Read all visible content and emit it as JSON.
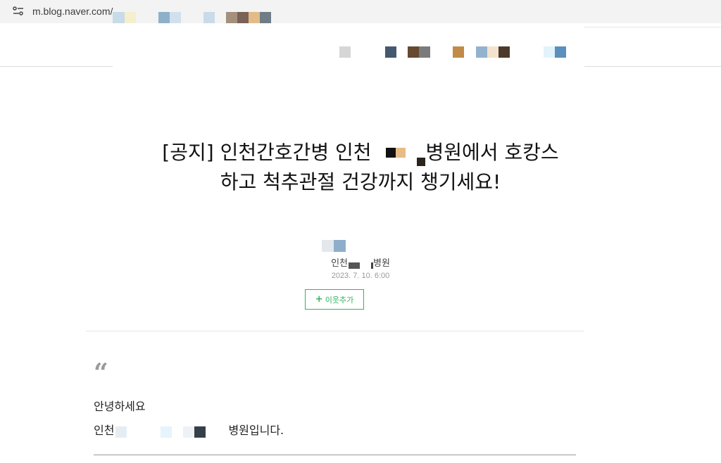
{
  "browser": {
    "url": "m.blog.naver.com/"
  },
  "post": {
    "title_line1": "[공지] 인천간호간병 인천",
    "title_line1_end": "병원에서 호캉스",
    "title_line2": "하고 척추관절 건강까지 챙기세요!",
    "author_prefix": "인천",
    "author_suffix": "병원",
    "date": "2023. 7. 10. 6:00",
    "follow_label": "이웃추가",
    "follow_icon": "plus-icon"
  },
  "body": {
    "quote_icon": "quote-icon",
    "greeting": "안녕하세요",
    "intro_prefix": "인천",
    "intro_suffix": "병원입니다."
  },
  "colors": {
    "follow_accent": "#34b35e",
    "redaction_tiles": [
      "#c7dbe9",
      "#f5efce",
      "#8fb0c9",
      "#d0e1ed",
      "#a3907d",
      "#7a6258",
      "#e2bc88",
      "#6e7d87",
      "#d6d6d6",
      "#445870",
      "#66492e",
      "#7b7b7b",
      "#c28a47",
      "#93b2ce",
      "#f3e3cc",
      "#4b3a2b",
      "#e2f3fb",
      "#5b8fbd"
    ]
  }
}
